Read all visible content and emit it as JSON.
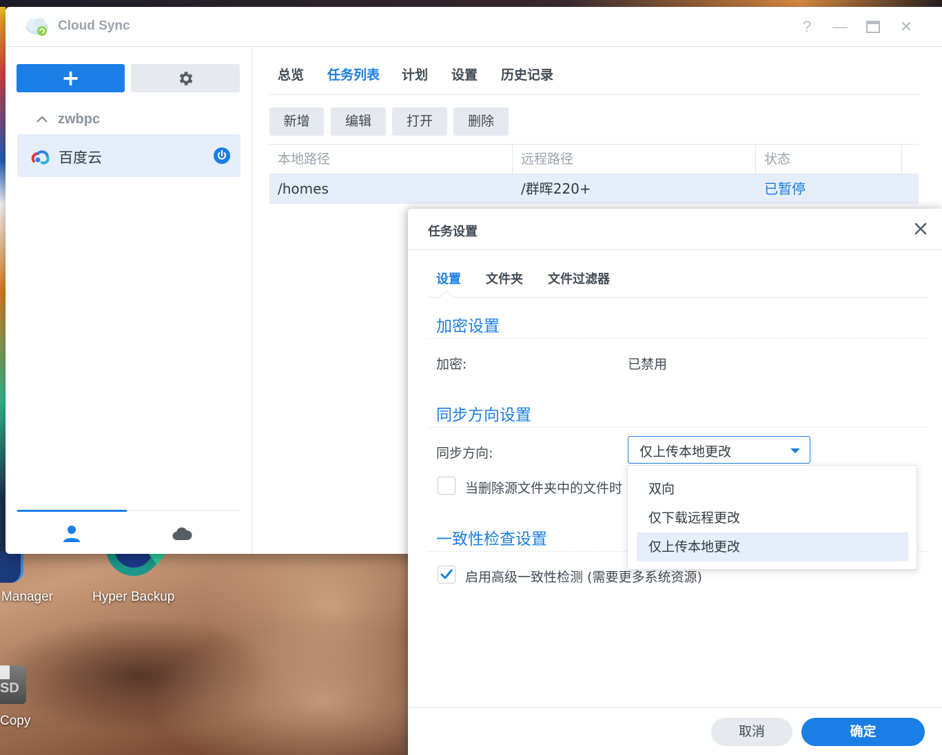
{
  "desktop": {
    "labels": {
      "manager": "Manager",
      "hyper_backup": "Hyper Backup",
      "sd": "SD",
      "copy": "Copy"
    }
  },
  "window": {
    "title": "Cloud Sync",
    "buttons": {
      "help": "?",
      "minimize": "—",
      "close": "✕"
    },
    "icons": {
      "app": "cloud-sync-icon",
      "help": "help-icon",
      "minimize": "minimize-icon",
      "maximize": "maximize-icon",
      "close": "close-icon"
    }
  },
  "sidebar": {
    "add_label": "+",
    "group_name": "zwbpc",
    "connection": {
      "name": "百度云",
      "status_icon": "power-icon"
    },
    "tabs": [
      {
        "icon": "user-icon",
        "active": true
      },
      {
        "icon": "cloud-icon",
        "active": false
      }
    ]
  },
  "main_tabs": [
    "总览",
    "任务列表",
    "计划",
    "设置",
    "历史记录"
  ],
  "active_main_tab": "任务列表",
  "toolbar": {
    "add": "新增",
    "edit": "编辑",
    "open": "打开",
    "delete": "删除"
  },
  "task_grid": {
    "columns": [
      "本地路径",
      "远程路径",
      "状态"
    ],
    "rows": [
      {
        "local": "/homes",
        "remote": "/群晖220+",
        "status": "已暂停"
      }
    ]
  },
  "dialog": {
    "title": "任务设置",
    "tabs": [
      "设置",
      "文件夹",
      "文件过滤器"
    ],
    "active_tab": "设置",
    "encryption": {
      "section": "加密设置",
      "label": "加密:",
      "value": "已禁用"
    },
    "sync_direction": {
      "section": "同步方向设置",
      "label": "同步方向:",
      "selected": "仅上传本地更改",
      "options": [
        "双向",
        "仅下载远程更改",
        "仅上传本地更改"
      ],
      "delete_checkbox_label": "当删除源文件夹中的文件时",
      "delete_checkbox_checked": false
    },
    "consistency": {
      "section": "一致性检查设置",
      "checkbox_label": "启用高级一致性检测 (需要更多系统资源)",
      "checkbox_checked": true
    },
    "buttons": {
      "cancel": "取消",
      "ok": "确定"
    }
  },
  "colors": {
    "accent": "#1a7ee6",
    "selected_row": "#e5eef9",
    "button_gray": "#e6e9ee",
    "text": "#414b55"
  }
}
